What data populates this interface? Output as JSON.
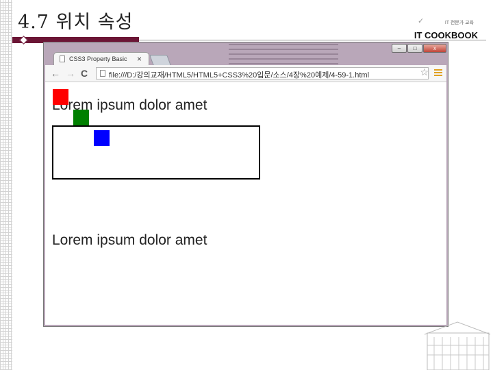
{
  "slide": {
    "title": "4.7 위치 속성",
    "publisher": {
      "subtitle": "IT 전문가 교육",
      "name": "IT COOKBOOK"
    }
  },
  "browser": {
    "tab_title": "CSS3 Property Basic",
    "tab_close": "×",
    "address": "file:///D:/강의교재/HTML5/HTML5+CSS3%20입문/소스/4장%20예제/4-59-1.html",
    "window_controls": [
      "–",
      "□",
      "x"
    ]
  },
  "page": {
    "text_1": "Lorem ipsum dolor amet",
    "text_2": "Lorem ipsum dolor amet",
    "colors": {
      "red": "#ff0000",
      "green": "#008000",
      "blue": "#0000ff"
    }
  },
  "icons": {
    "back": "arrow-left-icon",
    "forward": "arrow-right-icon",
    "reload": "reload-icon",
    "bookmark": "star-icon",
    "menu": "hamburger-menu-icon"
  }
}
